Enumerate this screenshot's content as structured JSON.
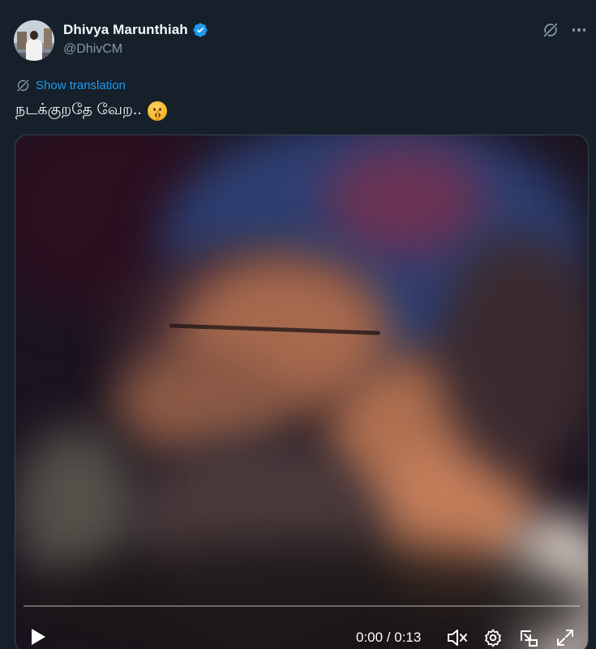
{
  "author": {
    "name": "Dhivya Marunthiah",
    "handle": "@DhivCM",
    "verified": true,
    "verified_color": "#1d9bf0"
  },
  "actions": {
    "grok_icon": "grok-icon",
    "more_icon": "more-icon"
  },
  "translation": {
    "label": "Show translation",
    "icon": "translate-icon"
  },
  "tweet": {
    "text": "நடக்குறதே வேற..",
    "emoji": "shushing-face-emoji"
  },
  "video": {
    "progress": 0.0,
    "time_current": "0:00",
    "time_separator": "/",
    "time_total": "0:13",
    "time_display": "0:00 / 0:13",
    "controls": [
      "play-icon",
      "mute-icon",
      "settings-icon",
      "picture-in-picture-icon",
      "fullscreen-icon"
    ]
  },
  "colors": {
    "background": "#15202b",
    "accent": "#1d9bf0",
    "secondary_text": "#8b98a5"
  }
}
